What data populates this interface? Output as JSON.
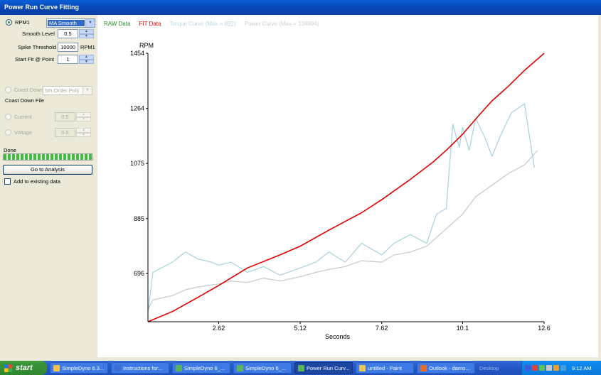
{
  "window": {
    "title": "Power Run Curve Fitting"
  },
  "panel": {
    "rpm_label": "RPM1",
    "mode_select": "MA Smooth",
    "smooth_level_label": "Smooth Level",
    "smooth_level_value": "0.5",
    "spike_threshold_label": "Spike Threshold",
    "spike_threshold_value": "10000",
    "spike_threshold_unit": "RPM1",
    "start_fit_label": "Start Fit @ Point",
    "start_fit_value": "1",
    "coast_down_label": "Coast Down",
    "coast_down_select": "5th Order Poly",
    "coast_down_file_label": "Coast Down File",
    "current_label": "Current",
    "current_value": "0.5",
    "voltage_label": "Voltage",
    "voltage_value": "0.5",
    "status_text": "Done",
    "progress_percent": 100,
    "go_button": "Go to Analysis",
    "add_existing_label": "Add to existing data"
  },
  "legend": [
    {
      "text": "RAW Data",
      "color": "#1f8f1f"
    },
    {
      "text": "FIT Data",
      "color": "#e00000"
    },
    {
      "text": "Torque Curve (Max = 892)",
      "color": "#b8d8e6"
    },
    {
      "text": "Power Curve (Max = 134894)",
      "color": "#d0d0d0"
    }
  ],
  "chart_data": {
    "type": "line",
    "ylabel": "RPM",
    "xlabel": "Seconds",
    "x_ticks": [
      2.62,
      5.12,
      7.62,
      10.1,
      12.6
    ],
    "y_ticks": [
      696,
      885,
      1075,
      1264,
      1454
    ],
    "xlim": [
      0.45,
      12.6
    ],
    "ylim": [
      530,
      1454
    ],
    "series": [
      {
        "name": "FIT Data",
        "color": "#e00000",
        "x": [
          0.45,
          1.2,
          2.0,
          2.62,
          3.5,
          4.5,
          5.12,
          6.0,
          7.0,
          7.62,
          8.5,
          9.2,
          9.6,
          10.1,
          10.6,
          11.0,
          11.5,
          12.0,
          12.6
        ],
        "y": [
          530,
          565,
          615,
          655,
          715,
          760,
          790,
          845,
          905,
          950,
          1020,
          1080,
          1120,
          1175,
          1240,
          1290,
          1340,
          1395,
          1454
        ]
      },
      {
        "name": "Torque Curve (Max = 892)",
        "color": "#a8d0de",
        "x": [
          0.45,
          0.6,
          1.2,
          1.6,
          2.0,
          2.4,
          2.62,
          3.0,
          3.5,
          4.0,
          4.5,
          5.12,
          5.6,
          6.0,
          6.5,
          7.0,
          7.62,
          8.0,
          8.5,
          9.0,
          9.3,
          9.6,
          9.8,
          10.0,
          10.1,
          10.3,
          10.5,
          10.8,
          11.0,
          11.3,
          11.6,
          12.0,
          12.3
        ],
        "y": [
          560,
          700,
          735,
          770,
          745,
          735,
          725,
          735,
          700,
          720,
          690,
          715,
          735,
          770,
          735,
          800,
          760,
          800,
          830,
          800,
          900,
          920,
          1210,
          1130,
          1200,
          1120,
          1230,
          1160,
          1100,
          1180,
          1250,
          1280,
          1060
        ]
      },
      {
        "name": "Power Curve (Max = 134894)",
        "color": "#c8c8c8",
        "x": [
          0.45,
          0.6,
          1.2,
          1.6,
          2.0,
          2.62,
          3.0,
          3.5,
          4.0,
          4.5,
          5.12,
          5.6,
          6.0,
          6.5,
          7.0,
          7.62,
          8.0,
          8.5,
          9.0,
          9.6,
          10.1,
          10.5,
          11.0,
          11.5,
          12.0,
          12.4
        ],
        "y": [
          570,
          605,
          620,
          640,
          650,
          660,
          670,
          665,
          680,
          670,
          685,
          700,
          710,
          720,
          740,
          735,
          760,
          770,
          790,
          850,
          900,
          960,
          1000,
          1040,
          1070,
          1120
        ]
      }
    ]
  },
  "taskbar": {
    "start": "start",
    "tasks": [
      {
        "label": "SimpleDyno 6.3...",
        "icon_color": "#f2c14e"
      },
      {
        "label": "Instructions for...",
        "icon_color": "#3b6fd6"
      },
      {
        "label": "SimpleDyno 6_...",
        "icon_color": "#5bb35b"
      },
      {
        "label": "SimpleDyno 6_...",
        "icon_color": "#5bb35b"
      },
      {
        "label": "Power Run Curv...",
        "icon_color": "#5bb35b"
      },
      {
        "label": "untitled - Paint",
        "icon_color": "#e8c45a"
      },
      {
        "label": "Outlook - damo...",
        "icon_color": "#e86a2a"
      }
    ],
    "desktop_label": "Desktop",
    "clock": "9:12 AM"
  }
}
